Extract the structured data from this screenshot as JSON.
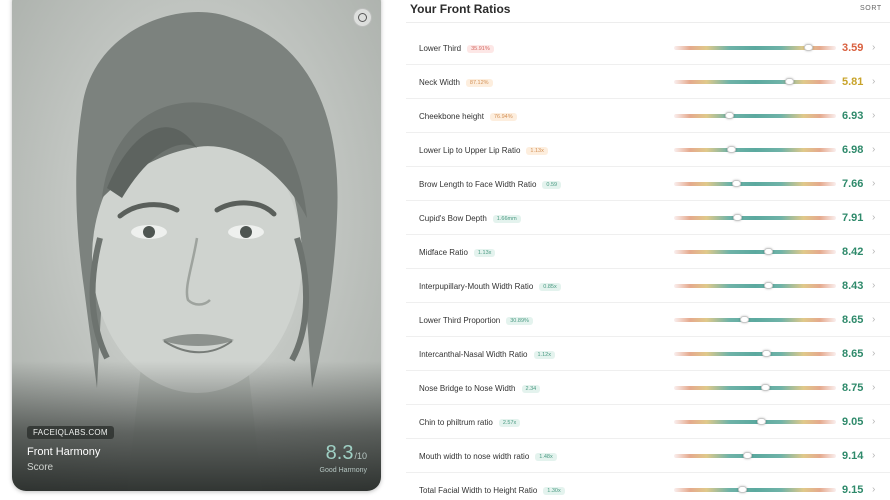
{
  "card": {
    "brand": "FACEIQLABS.COM",
    "title": "Front Harmony",
    "subtitle": "Score",
    "score": "8.3",
    "score_denominator": "/10",
    "score_label": "Good Harmony",
    "settings_icon": "gear-icon"
  },
  "panel": {
    "title": "Your Front Ratios",
    "sort_label": "SORT"
  },
  "colors": {
    "bad": "#d9603f",
    "warn": "#c8a32a",
    "good": "#2f8a6b",
    "accent": "#5ba99f"
  },
  "ratios": [
    {
      "label": "Lower Third",
      "badge": "35.91%",
      "badge_tone": "red",
      "value": "3.59",
      "value_tone": "bad",
      "position": 0.83
    },
    {
      "label": "Neck Width",
      "badge": "87.12%",
      "badge_tone": "orange",
      "value": "5.81",
      "value_tone": "warn",
      "position": 0.71
    },
    {
      "label": "Cheekbone height",
      "badge": "76.94%",
      "badge_tone": "orange",
      "value": "6.93",
      "value_tone": "good",
      "position": 0.34
    },
    {
      "label": "Lower Lip to Upper Lip Ratio",
      "badge": "1.13x",
      "badge_tone": "orange",
      "value": "6.98",
      "value_tone": "good",
      "position": 0.35
    },
    {
      "label": "Brow Length to Face Width Ratio",
      "badge": "0.59",
      "badge_tone": "green",
      "value": "7.66",
      "value_tone": "good",
      "position": 0.38
    },
    {
      "label": "Cupid's Bow Depth",
      "badge": "1.66mm",
      "badge_tone": "green",
      "value": "7.91",
      "value_tone": "good",
      "position": 0.39
    },
    {
      "label": "Midface Ratio",
      "badge": "1.13x",
      "badge_tone": "green",
      "value": "8.42",
      "value_tone": "good",
      "position": 0.58
    },
    {
      "label": "Interpupillary-Mouth Width Ratio",
      "badge": "0.85x",
      "badge_tone": "green",
      "value": "8.43",
      "value_tone": "good",
      "position": 0.58
    },
    {
      "label": "Lower Third Proportion",
      "badge": "30.89%",
      "badge_tone": "green",
      "value": "8.65",
      "value_tone": "good",
      "position": 0.43
    },
    {
      "label": "Intercanthal-Nasal Width Ratio",
      "badge": "1.12x",
      "badge_tone": "green",
      "value": "8.65",
      "value_tone": "good",
      "position": 0.57
    },
    {
      "label": "Nose Bridge to Nose Width",
      "badge": "2.34",
      "badge_tone": "green",
      "value": "8.75",
      "value_tone": "good",
      "position": 0.56
    },
    {
      "label": "Chin to philtrum ratio",
      "badge": "2.57x",
      "badge_tone": "green",
      "value": "9.05",
      "value_tone": "good",
      "position": 0.54
    },
    {
      "label": "Mouth width to nose width ratio",
      "badge": "1.48x",
      "badge_tone": "green",
      "value": "9.14",
      "value_tone": "good",
      "position": 0.45
    },
    {
      "label": "Total Facial Width to Height Ratio",
      "badge": "1.30x",
      "badge_tone": "green",
      "value": "9.15",
      "value_tone": "good",
      "position": 0.42
    }
  ]
}
